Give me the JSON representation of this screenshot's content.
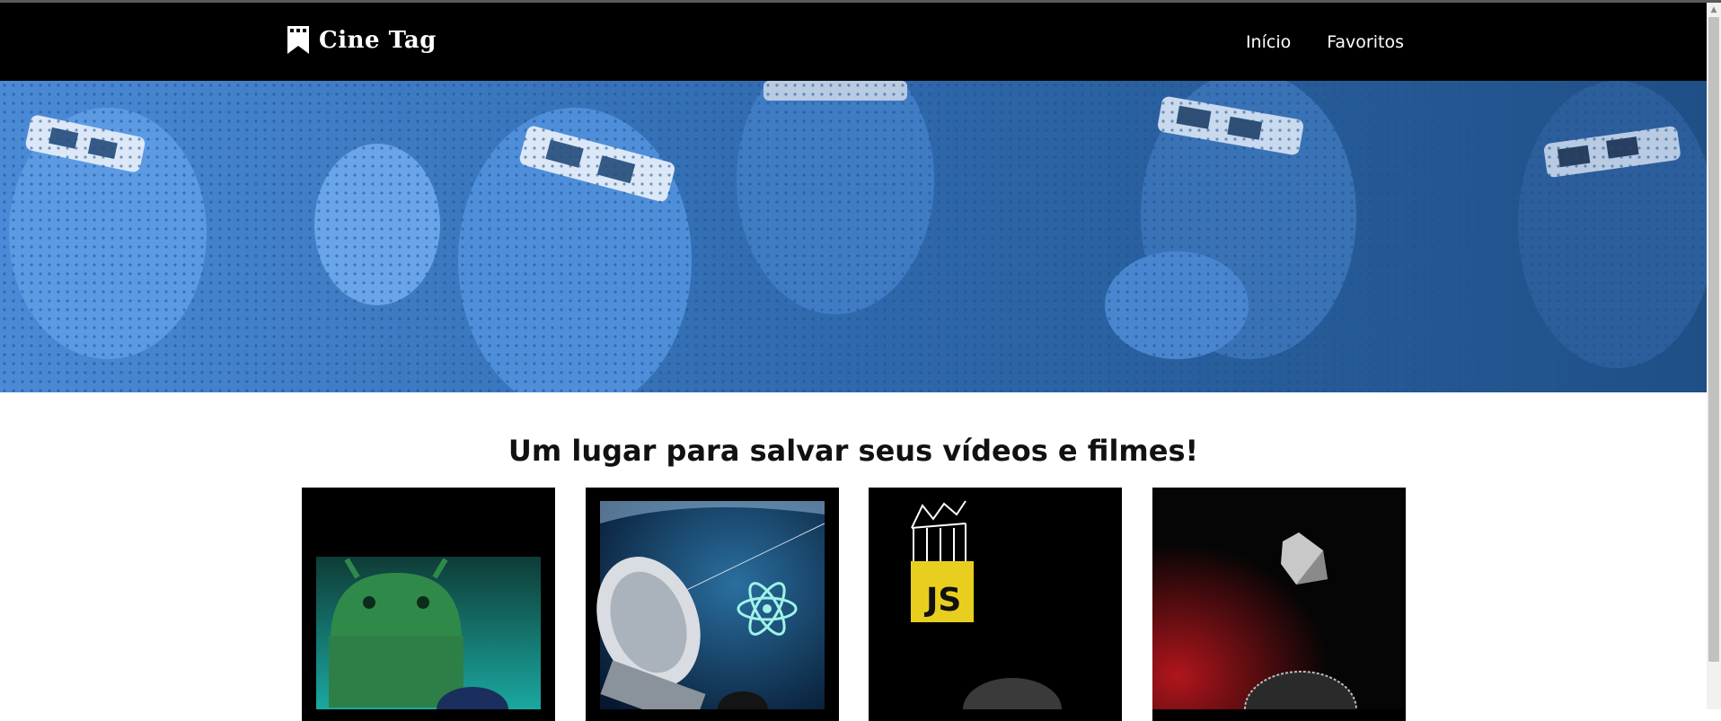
{
  "header": {
    "logo_text": "Cine Tag",
    "logo_icon": "bookmark-film-icon",
    "nav": [
      {
        "label": "Início"
      },
      {
        "label": "Favoritos"
      }
    ]
  },
  "banner": {
    "image": "audience-with-3d-glasses",
    "tint_color": "#3c7dc9"
  },
  "main": {
    "title": "Um lugar para salvar seus vídeos e filmes!"
  },
  "cards": [
    {
      "thumbnail": "android-mascot-video-thumbnail"
    },
    {
      "thumbnail": "react-satellite-video-thumbnail"
    },
    {
      "thumbnail": "javascript-logo-video-thumbnail",
      "badge_text": "JS"
    },
    {
      "thumbnail": "dart-logo-video-thumbnail"
    }
  ],
  "colors": {
    "header_bg": "#000000",
    "banner_tint": "#3c7dc9",
    "js_yellow": "#e8cf1f"
  }
}
